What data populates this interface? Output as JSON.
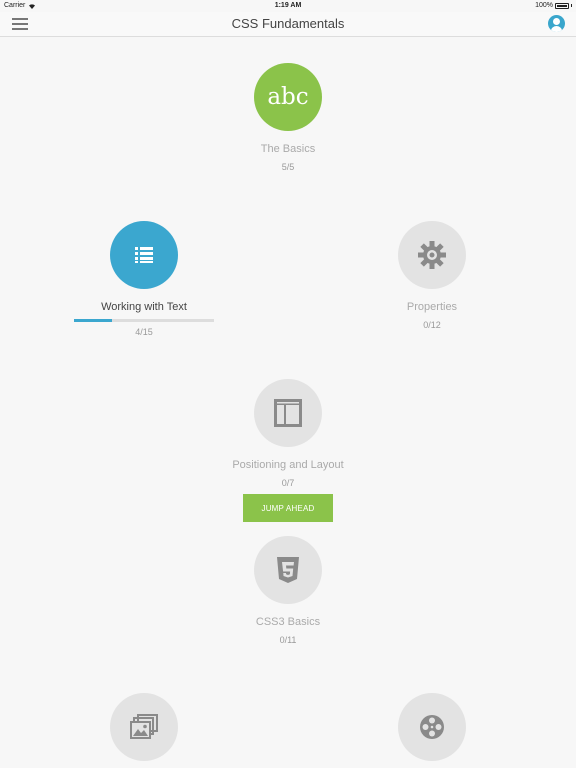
{
  "status": {
    "carrier": "Carrier",
    "time": "1:19 AM",
    "battery": "100%"
  },
  "header": {
    "title": "CSS Fundamentals",
    "menu_icon": "hamburger-icon",
    "profile_icon": "user-icon"
  },
  "colors": {
    "accent_green": "#8bc34a",
    "accent_blue": "#3ba7cf",
    "locked_gray": "#e3e3e3"
  },
  "lessons": [
    {
      "title": "The Basics",
      "progress": "5/5",
      "icon": "abc",
      "state": "completed"
    },
    {
      "title": "Working with Text",
      "progress": "4/15",
      "icon": "list-icon",
      "state": "in-progress",
      "progress_fraction": 0.27
    },
    {
      "title": "Properties",
      "progress": "0/12",
      "icon": "gear-icon",
      "state": "locked"
    },
    {
      "title": "Positioning and Layout",
      "progress": "0/7",
      "icon": "layout-icon",
      "state": "locked"
    },
    {
      "title": "CSS3 Basics",
      "progress": "0/11",
      "icon": "css3-icon",
      "state": "locked"
    },
    {
      "title": "",
      "progress": "",
      "icon": "images-icon",
      "state": "locked"
    },
    {
      "title": "",
      "progress": "",
      "icon": "film-reel-icon",
      "state": "locked"
    }
  ],
  "jump_ahead": "JUMP AHEAD"
}
